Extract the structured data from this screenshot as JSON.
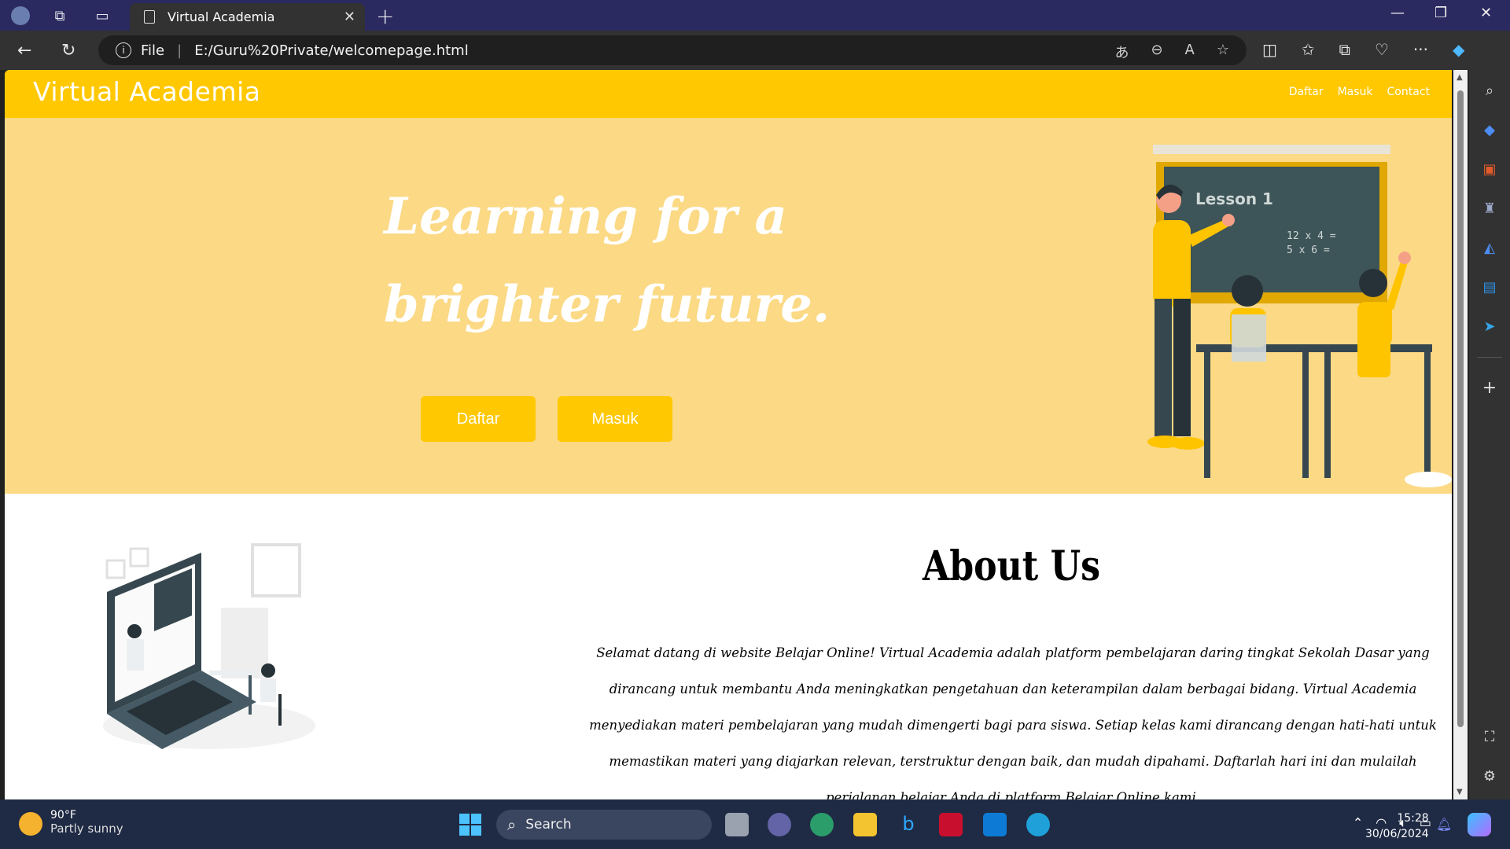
{
  "browser": {
    "tab_title": "Virtual Academia",
    "new_tab": "+",
    "file_label": "File",
    "url": "E:/Guru%20Private/welcomepage.html",
    "window_controls": [
      "—",
      "❐",
      "✕"
    ]
  },
  "site": {
    "brand": "Virtual Academia",
    "menu": [
      "Daftar",
      "Masuk",
      "Contact"
    ],
    "hero": {
      "title": "Learning for a brighter future.",
      "buttons": [
        "Daftar",
        "Masuk"
      ],
      "illustration_lesson": "Lesson 1",
      "illustration_math": [
        "12 x 4 =",
        "5 x 6 ="
      ]
    },
    "about": {
      "title": "About Us",
      "text": "Selamat datang di website Belajar Online! Virtual Academia adalah platform pembelajaran daring tingkat Sekolah Dasar yang dirancang untuk membantu Anda meningkatkan pengetahuan dan keterampilan dalam berbagai bidang. Virtual Academia menyediakan materi pembelajaran yang mudah dimengerti bagi para siswa. Setiap kelas kami dirancang dengan hati-hati untuk memastikan materi yang diajarkan relevan, terstruktur dengan baik, dan mudah dipahami. Daftarlah hari ini dan mulailah perjalanan belajar Anda di platform Belajar Online kami."
    }
  },
  "taskbar": {
    "weather_temp": "90°F",
    "weather_cond": "Partly sunny",
    "search_placeholder": "Search",
    "time": "15:28",
    "date": "30/06/2024"
  },
  "colors": {
    "header_yellow": "#ffc800",
    "hero_bg": "#fbd985",
    "chalkboard": "#3d5458"
  }
}
